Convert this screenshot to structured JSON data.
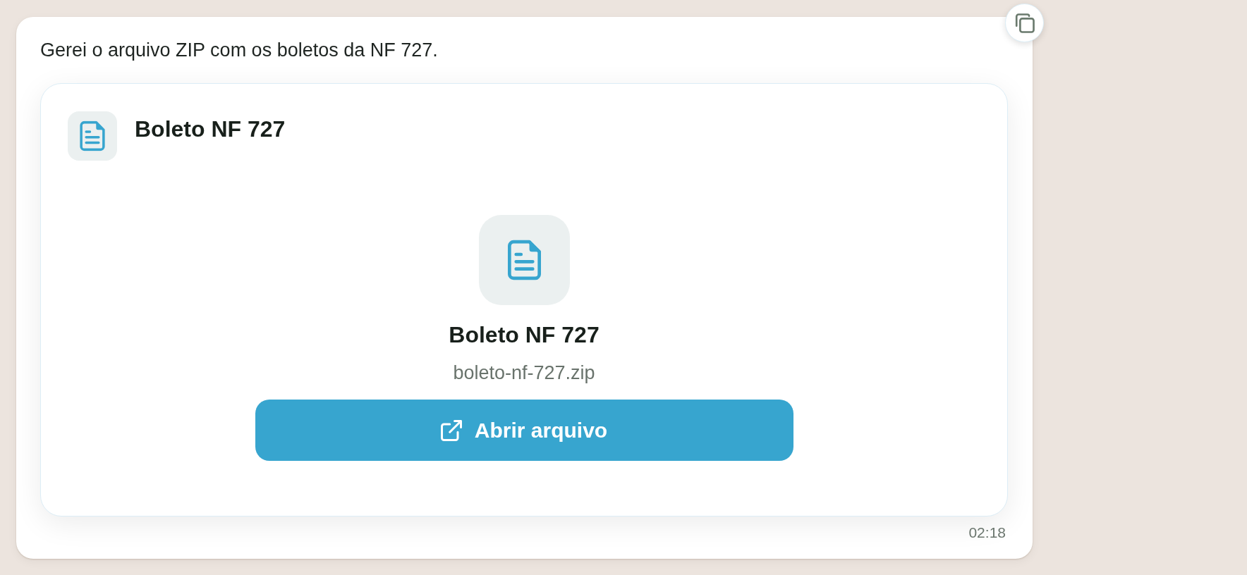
{
  "message": {
    "text": "Gerei o arquivo ZIP com os boletos da NF 727.",
    "time": "02:18"
  },
  "attachment": {
    "title": "Boleto NF 727",
    "preview": {
      "title": "Boleto NF 727",
      "file_name": "boleto-nf-727.zip"
    },
    "open_button": {
      "label": "Abrir arquivo"
    }
  }
}
